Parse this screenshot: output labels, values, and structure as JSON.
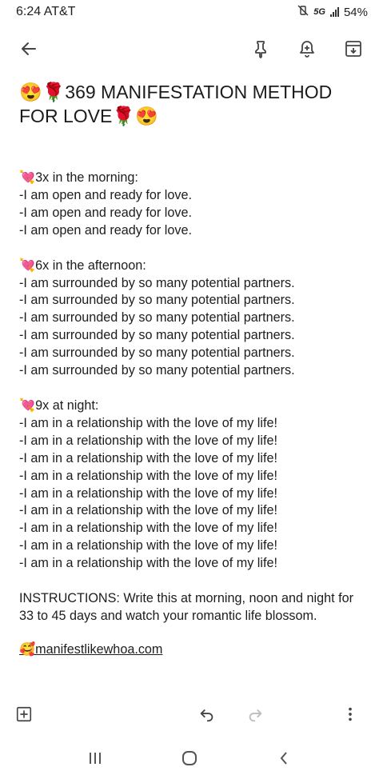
{
  "status": {
    "time": "6:24 AT&T",
    "network": "5G",
    "battery": "54%"
  },
  "note": {
    "title": "😍🌹369 MANIFESTATION METHOD FOR LOVE🌹😍",
    "sections": [
      {
        "heading": "💘3x in the morning:",
        "lines": [
          "-I am open and ready for love.",
          "-I am open and ready for love.",
          "-I am open and ready for love."
        ]
      },
      {
        "heading": "💘6x in the afternoon:",
        "lines": [
          "-I am surrounded by so many potential partners.",
          "-I am surrounded by so many potential partners.",
          "-I am surrounded by so many potential partners.",
          "-I am surrounded by so many potential partners.",
          "-I am surrounded by so many potential partners.",
          "-I am surrounded by so many potential partners."
        ]
      },
      {
        "heading": "💘9x at night:",
        "lines": [
          "-I am in a relationship with the love of my life!",
          "-I am in a relationship with the love of my life!",
          "-I am in a relationship with the love of my life!",
          "-I am in a relationship with the love of my life!",
          "-I am in a relationship with the love of my life!",
          "-I am in a relationship with the love of my life!",
          "-I am in a relationship with the love of my life!",
          "-I am in a relationship with the love of my life!",
          "-I am in a relationship with the love of my life!"
        ]
      }
    ],
    "instructions": "INSTRUCTIONS: Write this at morning, noon and night for 33 to 45 days and watch your romantic life blossom.",
    "link": "🥰manifestlikewhoa.com"
  },
  "icons": {
    "back": "arrow-left-icon",
    "pin": "pin-icon",
    "reminder": "bell-plus-icon",
    "archive": "archive-icon",
    "add": "add-box-icon",
    "undo": "undo-icon",
    "redo": "redo-icon",
    "more": "more-vert-icon",
    "recents": "recents-icon",
    "home": "home-icon",
    "nav_back": "chevron-left-icon"
  }
}
